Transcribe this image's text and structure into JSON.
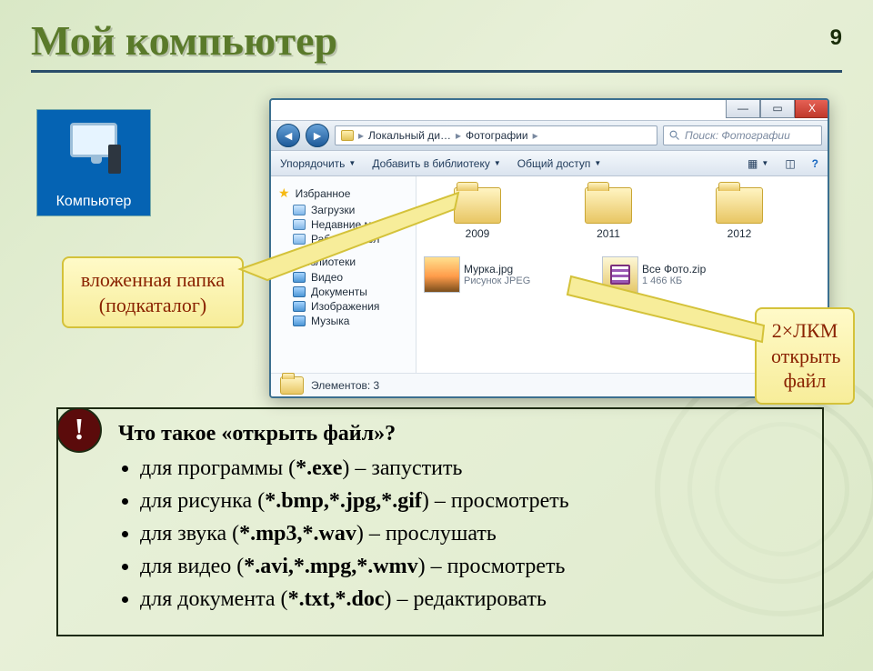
{
  "page_number": "9",
  "title": "Мой компьютер",
  "computer_icon_label": "Компьютер",
  "explorer": {
    "window_controls": {
      "min": "—",
      "max": "▭",
      "close": "X"
    },
    "path_segments": [
      "Локальный ди…",
      "Фотографии"
    ],
    "search_placeholder": "Поиск: Фотографии",
    "toolbar": {
      "organize": "Упорядочить",
      "add_library": "Добавить в библиотеку",
      "share": "Общий доступ"
    },
    "sidebar": {
      "favorites": "Избранное",
      "downloads": "Загрузки",
      "recent": "Недавние места",
      "desktop": "Рабочий стол",
      "libraries": "Библиотеки",
      "video": "Видео",
      "documents": "Документы",
      "images": "Изображения",
      "music": "Музыка"
    },
    "folders": [
      "2009",
      "2011",
      "2012"
    ],
    "file_jpg": {
      "name": "Мурка.jpg",
      "meta": "Рисунок JPEG"
    },
    "file_zip": {
      "name": "Все Фото.zip",
      "meta": "1 466 КБ"
    },
    "status": "Элементов: 3"
  },
  "callout_subfolder": {
    "l1": "вложенная папка",
    "l2": "(подкаталог)"
  },
  "callout_dblclick": {
    "l1": "2×ЛКМ",
    "l2": "открыть",
    "l3": "файл"
  },
  "info": {
    "badge": "!",
    "question": "Что такое «открыть файл»?",
    "bullets": {
      "b1a": "для программы (",
      "b1ext": "*.exe",
      "b1b": ") – запустить",
      "b2a": "для рисунка (",
      "b2ext": "*.bmp,*.jpg,*.gif",
      "b2b": ") – просмотреть",
      "b3a": "для звука (",
      "b3ext": "*.mp3,*.wav",
      "b3b": ") – прослушать",
      "b4a": "для видео (",
      "b4ext": "*.avi,*.mpg,*.wmv",
      "b4b": ") – просмотреть",
      "b5a": "для документа (",
      "b5ext": "*.txt,*.doc",
      "b5b": ") – редактировать"
    }
  }
}
